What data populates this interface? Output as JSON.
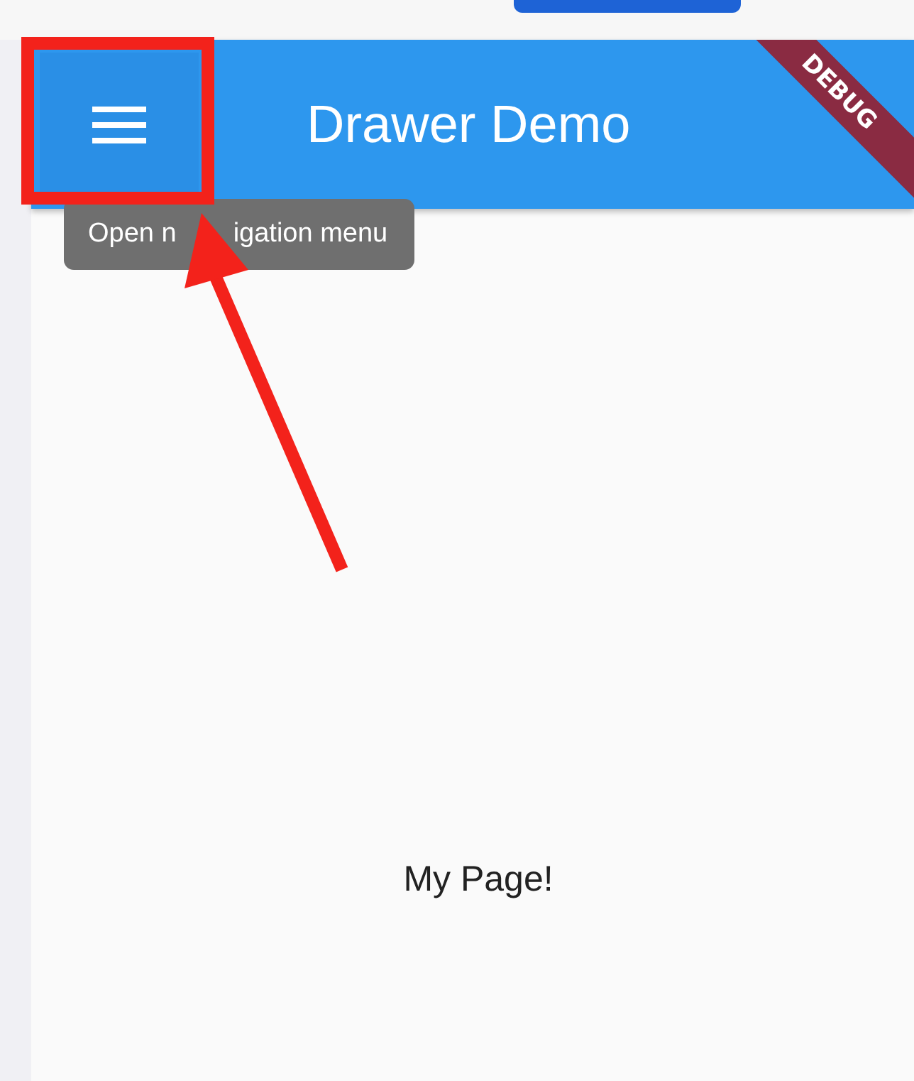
{
  "app_bar": {
    "title": "Drawer Demo",
    "banner": "DEBUG"
  },
  "tooltip": {
    "parts": [
      "Open n",
      "igation menu"
    ]
  },
  "body": {
    "text": "My Page!"
  }
}
